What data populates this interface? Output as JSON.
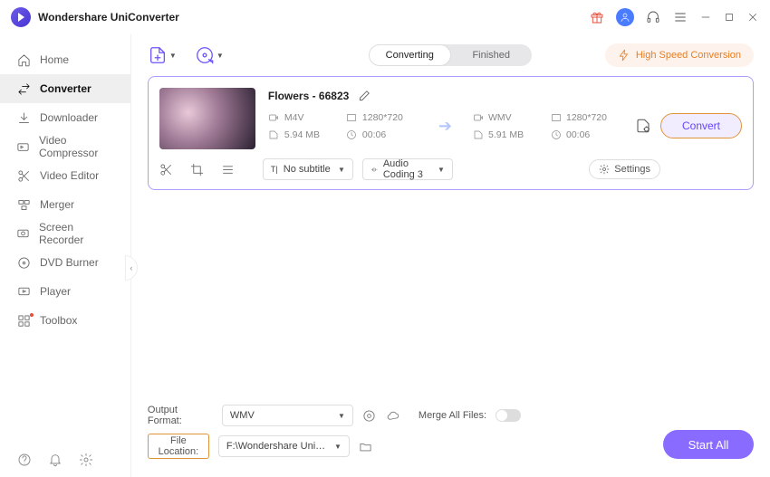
{
  "app": {
    "title": "Wondershare UniConverter"
  },
  "sidebar": {
    "items": [
      {
        "label": "Home"
      },
      {
        "label": "Converter"
      },
      {
        "label": "Downloader"
      },
      {
        "label": "Video Compressor"
      },
      {
        "label": "Video Editor"
      },
      {
        "label": "Merger"
      },
      {
        "label": "Screen Recorder"
      },
      {
        "label": "DVD Burner"
      },
      {
        "label": "Player"
      },
      {
        "label": "Toolbox"
      }
    ]
  },
  "toolbar": {
    "tabs": {
      "converting": "Converting",
      "finished": "Finished"
    },
    "highspeed": "High Speed Conversion"
  },
  "file": {
    "name": "Flowers - 66823",
    "src": {
      "format": "M4V",
      "resolution": "1280*720",
      "size": "5.94 MB",
      "duration": "00:06"
    },
    "dst": {
      "format": "WMV",
      "resolution": "1280*720",
      "size": "5.91 MB",
      "duration": "00:06"
    },
    "subtitle": "No subtitle",
    "audio": "Audio Coding 3",
    "settings": "Settings",
    "convert": "Convert"
  },
  "bottom": {
    "output_format_label": "Output Format:",
    "output_format": "WMV",
    "file_location_label": "File Location:",
    "file_location": "F:\\Wondershare UniConverter",
    "merge_label": "Merge All Files:",
    "start_all": "Start All"
  }
}
